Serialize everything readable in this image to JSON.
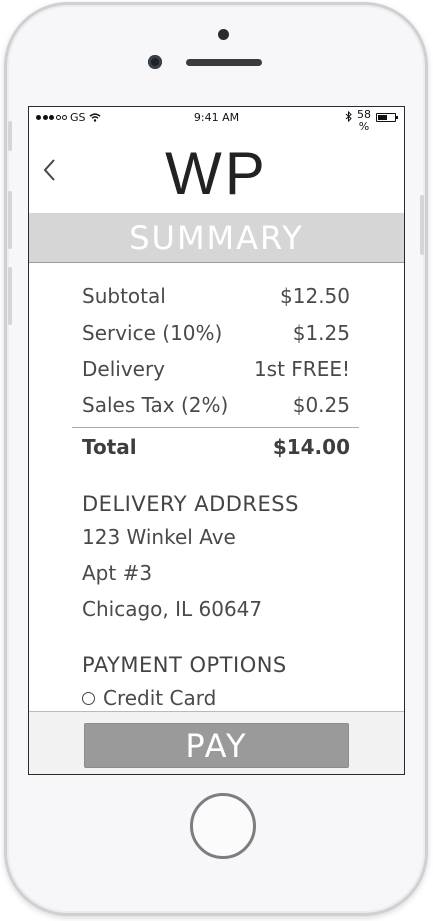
{
  "status_bar": {
    "carrier": "GS",
    "time": "9:41 AM",
    "battery_percent": "58 %",
    "battery_level": 0.58
  },
  "header": {
    "logo": "WP"
  },
  "summary": {
    "title": "SUMMARY",
    "lines": [
      {
        "label": "Subtotal",
        "value": "$12.50"
      },
      {
        "label": "Service (10%)",
        "value": "$1.25"
      },
      {
        "label": "Delivery",
        "value": "1st FREE!"
      },
      {
        "label": "Sales Tax (2%)",
        "value": "$0.25"
      }
    ],
    "total": {
      "label": "Total",
      "value": "$14.00"
    }
  },
  "delivery_address": {
    "title": "DELIVERY ADDRESS",
    "lines": [
      "123 Winkel Ave",
      "Apt #3",
      "Chicago, IL 60647"
    ]
  },
  "payment_options": {
    "title": "PAYMENT OPTIONS",
    "options": [
      "Credit Card"
    ]
  },
  "footer": {
    "pay_label": "PAY"
  },
  "icons": {
    "back": "chevron-left-icon",
    "wifi": "wifi-icon",
    "bluetooth": "bluetooth-icon",
    "battery": "battery-icon"
  }
}
